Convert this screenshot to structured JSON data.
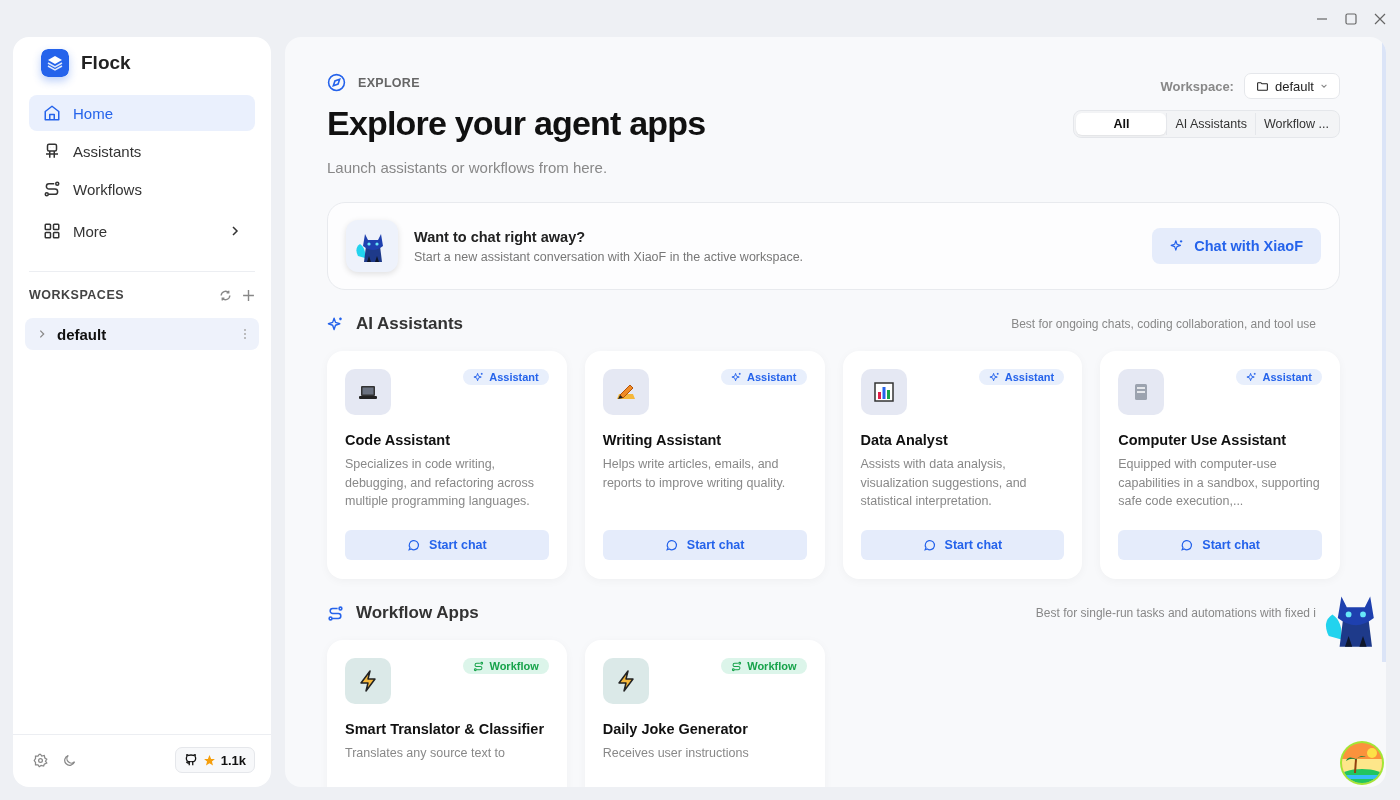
{
  "app": {
    "name": "Flock"
  },
  "nav": [
    {
      "label": "Home",
      "selected": true,
      "submenu": false
    },
    {
      "label": "Assistants",
      "selected": false,
      "submenu": false
    },
    {
      "label": "Workflows",
      "selected": false,
      "submenu": false
    },
    {
      "label": "More",
      "selected": false,
      "submenu": true
    }
  ],
  "workspaces": {
    "title": "WORKSPACES",
    "items": [
      {
        "name": "default",
        "selected": true,
        "expanded": false
      }
    ]
  },
  "github": {
    "stars": "1.1k"
  },
  "header": {
    "eyebrow": "EXPLORE",
    "title": "Explore your agent apps",
    "subtitle": "Launch assistants or workflows from here.",
    "workspace_label": "Workspace:",
    "workspace_value": "default"
  },
  "filters": [
    {
      "label": "All",
      "selected": true
    },
    {
      "label": "AI Assistants",
      "selected": false
    },
    {
      "label": "Workflow ...",
      "selected": false
    }
  ],
  "promo": {
    "title": "Want to chat right away?",
    "text": "Start a new assistant conversation with XiaoF in the active workspace.",
    "button": "Chat with XiaoF"
  },
  "sections": [
    {
      "kind": "assistant",
      "title": "AI Assistants",
      "note": "Best for ongoing chats, coding collaboration, and tool use",
      "apps": [
        {
          "name": "Code Assistant",
          "badge": "Assistant",
          "description": "Specializes in code writing, debugging, and refactoring across multiple programming languages.",
          "action": "Start chat"
        },
        {
          "name": "Writing Assistant",
          "badge": "Assistant",
          "description": "Helps write articles, emails, and reports to improve writing quality.",
          "action": "Start chat"
        },
        {
          "name": "Data Analyst",
          "badge": "Assistant",
          "description": "Assists with data analysis, visualization suggestions, and statistical interpretation.",
          "action": "Start chat"
        },
        {
          "name": "Computer Use Assistant",
          "badge": "Assistant",
          "description": "Equipped with computer-use capabilities in a sandbox, supporting safe code execution,...",
          "action": "Start chat"
        }
      ]
    },
    {
      "kind": "workflow",
      "title": "Workflow Apps",
      "note": "Best for single-run tasks and automations with fixed i",
      "apps": [
        {
          "name": "Smart Translator & Classifier",
          "badge": "Workflow",
          "description": "Translates any source text to"
        },
        {
          "name": "Daily Joke Generator",
          "badge": "Workflow",
          "description": "Receives user instructions"
        }
      ]
    }
  ]
}
